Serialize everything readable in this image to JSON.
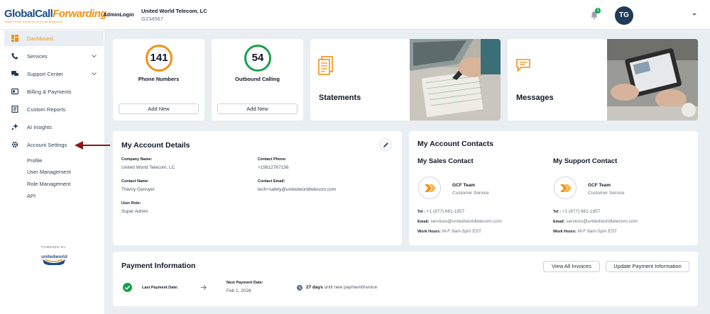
{
  "header": {
    "logo_text_a": "GlobalCall",
    "logo_text_b": "Forwarding",
    "logo_tagline": "Smart Phone Solutions for Smart Business®",
    "admin_login": "AdminLogin",
    "company_name": "United World Telecom, LC",
    "company_id": "G234567",
    "notification_count": "1",
    "avatar_initials": "TG"
  },
  "sidebar": {
    "items": [
      {
        "label": "Dashboard",
        "icon": "dashboard-icon"
      },
      {
        "label": "Services",
        "icon": "phone-icon"
      },
      {
        "label": "Support Center",
        "icon": "chat-icon"
      },
      {
        "label": "Billing & Payments",
        "icon": "billing-icon"
      },
      {
        "label": "Custom Reports",
        "icon": "report-icon"
      },
      {
        "label": "AI Insights",
        "icon": "sparkle-icon"
      },
      {
        "label": "Account Settings",
        "icon": "gear-icon"
      }
    ],
    "sub_items": [
      "Profile",
      "User Management",
      "Role Management",
      "API"
    ],
    "powered_by": "POWERED BY",
    "powered_logo": "unitedworld"
  },
  "stats": [
    {
      "value": "141",
      "label": "Phone Numbers",
      "button": "Add New",
      "color": "#f29114"
    },
    {
      "value": "54",
      "label": "Outbound Calling",
      "button": "Add New",
      "color": "#16a34a"
    }
  ],
  "tiles": {
    "statements": "Statements",
    "messages": "Messages"
  },
  "account_details": {
    "title": "My Account Details",
    "fields": [
      {
        "label": "Company Name:",
        "value": "United World Telecom, LC"
      },
      {
        "label": "Contact Phone:",
        "value": "+15612767156"
      },
      {
        "label": "Contact Name:",
        "value": "Thierry Genoyer"
      },
      {
        "label": "Contact Email:",
        "value": "tech+safety@unitedworldtelecom.com"
      },
      {
        "label": "User Role:",
        "value": "Super Admin"
      }
    ]
  },
  "contacts": {
    "title": "My Account Contacts",
    "sales": {
      "heading": "My Sales Contact",
      "name": "GCF Team",
      "role": "Customer Service",
      "tel_label": "Tel :",
      "tel": "+1 (877) 661-1857",
      "email_label": "Email:",
      "email": "services@unitedworldtelecom.com",
      "hours_label": "Work Hours:",
      "hours": "M-F 8am-5pm EST"
    },
    "support": {
      "heading": "My Support Contact",
      "name": "GCF Team",
      "role": "Customer Service",
      "tel_label": "Tel :",
      "tel": "+1 (877) 661-1857",
      "email_label": "Email:",
      "email": "services@unitedworldtelecom.com",
      "hours_label": "Work Hours:",
      "hours": "M-F 8am-5pm EST"
    }
  },
  "payment": {
    "title": "Payment Information",
    "view_invoices": "View All Invoices",
    "update_payment": "Update Payment Information",
    "last_label": "Last Payment Date:",
    "next_label": "Next Payment Date:",
    "next_value": "Feb 1, 2026",
    "days_bold": "27 days",
    "days_rest": "until new payment/invoice"
  },
  "colors": {
    "accent": "#f29114",
    "brand": "#1f4f8a",
    "success": "#16a34a",
    "arrow": "#8b1a1a"
  }
}
